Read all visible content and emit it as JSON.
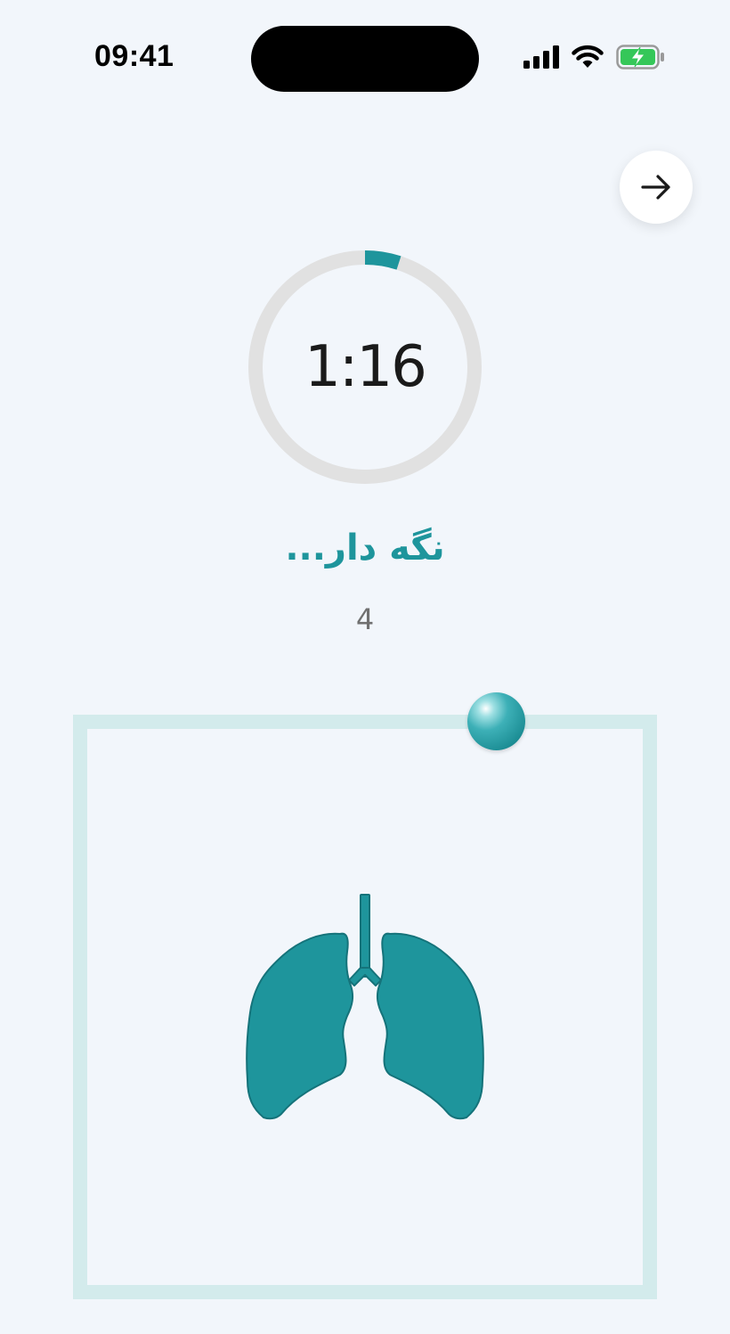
{
  "status_bar": {
    "time": "09:41"
  },
  "nav": {
    "next_icon": "arrow-right-icon"
  },
  "timer": {
    "time_text": "1:16",
    "progress_fraction": 0.05
  },
  "breathing": {
    "phase_text": "نگه دار...",
    "count": "4"
  },
  "colors": {
    "accent": "#1e959c",
    "background": "#f2f6fb",
    "box_border": "#d3ebec",
    "ring_track": "#e1e1e1"
  }
}
